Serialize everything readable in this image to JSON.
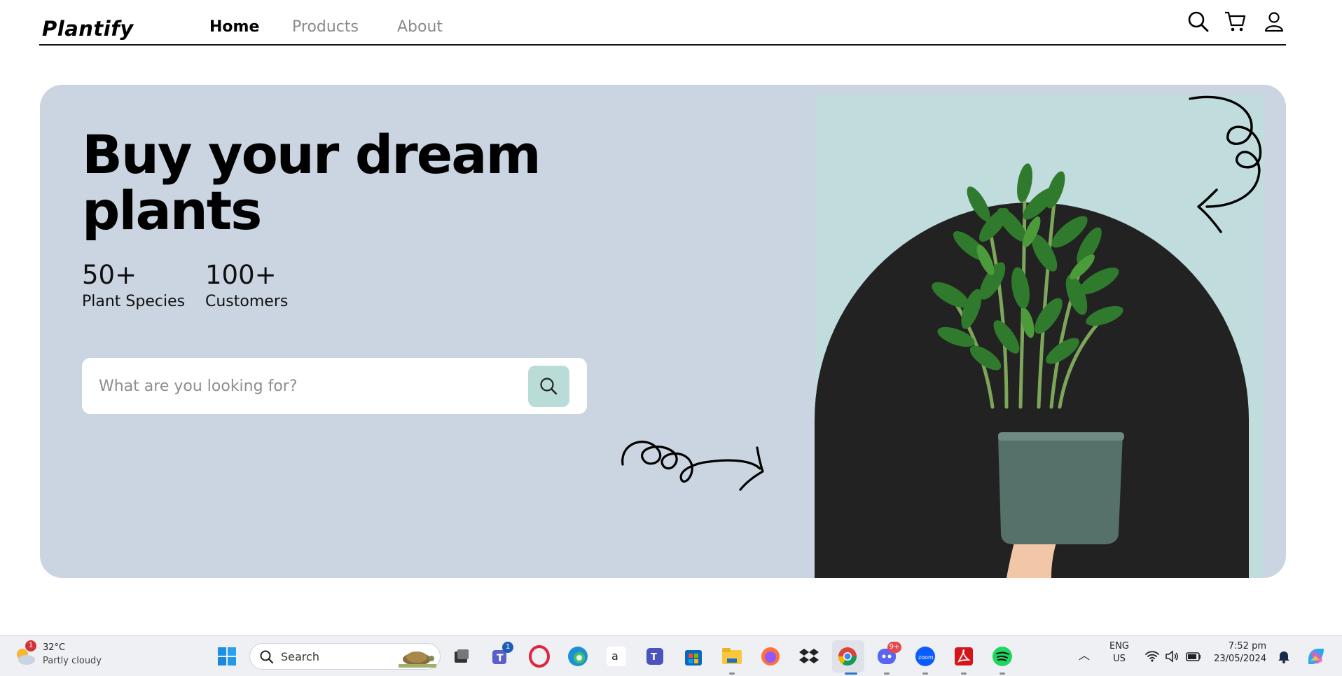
{
  "brand": {
    "logo": "Plantify"
  },
  "nav": {
    "links": [
      {
        "label": "Home",
        "active": true
      },
      {
        "label": "Products",
        "active": false
      },
      {
        "label": "About",
        "active": false
      }
    ],
    "icons": [
      "search-icon",
      "cart-icon",
      "user-icon"
    ]
  },
  "hero": {
    "title_line1": "Buy your dream",
    "title_line2": "plants",
    "stats": [
      {
        "value": "50+",
        "label": "Plant Species"
      },
      {
        "value": "100+",
        "label": "Customers"
      }
    ],
    "search": {
      "placeholder": "What are you looking for?"
    },
    "colors": {
      "hero_bg": "#cbd5e1",
      "panel_bg": "#c0dcdd",
      "arch": "#222222",
      "search_button": "#b9dcd9"
    }
  },
  "taskbar": {
    "weather": {
      "temp": "32°C",
      "condition": "Partly cloudy",
      "badge": "1"
    },
    "search_placeholder": "Search",
    "teams_badge": "1",
    "discord_badge": "9+",
    "language": {
      "line1": "ENG",
      "line2": "US"
    },
    "time": "7:52 pm",
    "date": "23/05/2024",
    "apps": [
      "windows-start-icon",
      "task-view-icon",
      "teams-icon",
      "opera-icon",
      "edge-icon",
      "amazon-icon",
      "teams-new-icon",
      "store-icon",
      "file-explorer-icon",
      "firefox-icon",
      "dropbox-icon",
      "chrome-icon",
      "discord-icon",
      "zoom-icon",
      "acrobat-icon",
      "spotify-icon"
    ]
  }
}
